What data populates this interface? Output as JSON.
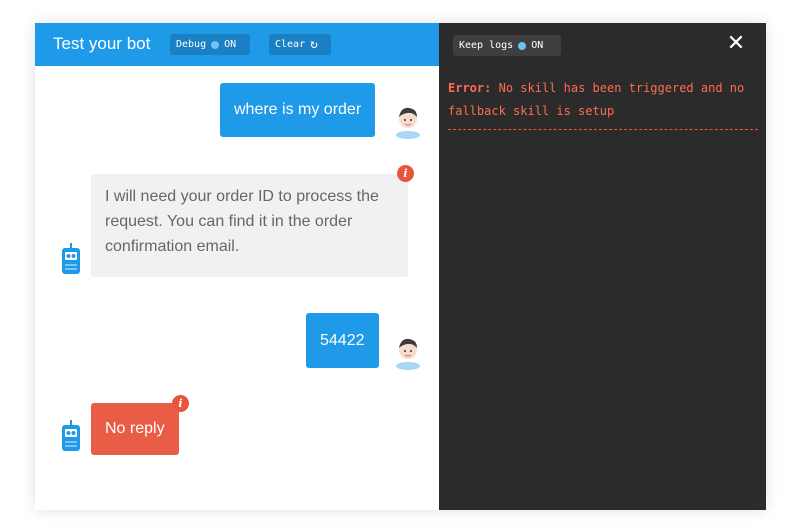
{
  "chat": {
    "title": "Test your bot",
    "debug": {
      "label": "Debug",
      "state": "ON"
    },
    "clear": {
      "label": "Clear",
      "icon": "refresh-icon"
    },
    "messages": [
      {
        "from": "user",
        "text": "where is my order"
      },
      {
        "from": "bot",
        "text": "I will need your order ID to process the request. You can find it in the order confirmation email.",
        "badge": "i"
      },
      {
        "from": "user",
        "text": "54422"
      },
      {
        "from": "bot",
        "text": "No reply",
        "badge": "i",
        "status": "error"
      }
    ]
  },
  "logs": {
    "keep_logs": {
      "label": "Keep logs",
      "state": "ON"
    },
    "close_icon": "close-icon",
    "error_label": "Error:",
    "error_message": "No skill has been triggered and no fallback skill is setup"
  },
  "colors": {
    "header": "#1f9ae8",
    "user_bubble": "#1f9ae8",
    "bot_bubble": "#f1f1f1",
    "error": "#e95c46",
    "log_panel": "#2b2b2b",
    "log_text": "#ff6b52"
  }
}
